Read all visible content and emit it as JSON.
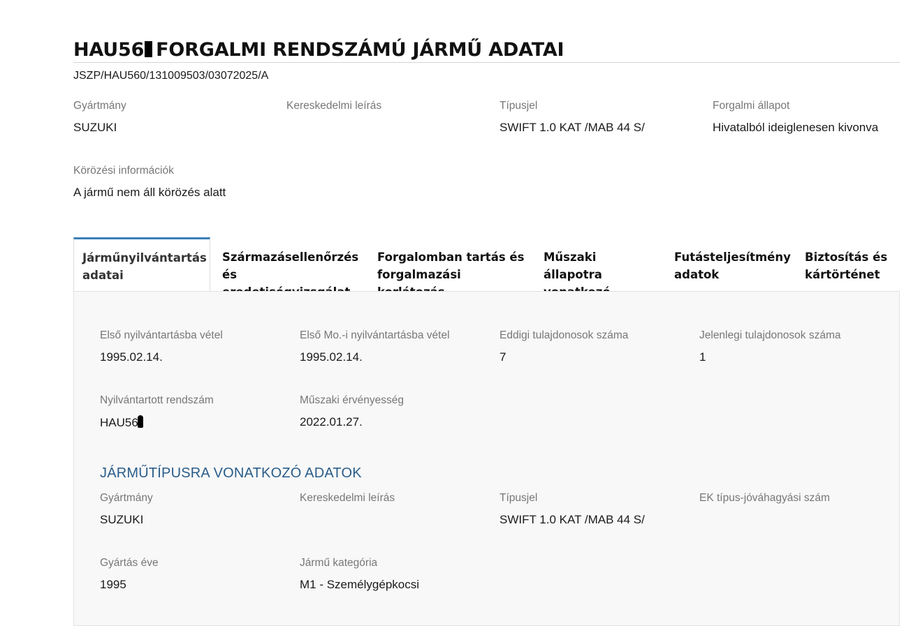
{
  "header": {
    "plate_prefix": "HAU56",
    "title_rest": "FORGALMI RENDSZÁMÚ JÁRMŰ ADATAI",
    "reference": "JSZP/HAU560/131009503/03072025/A"
  },
  "summary": {
    "gyartmany_label": "Gyártmány",
    "gyartmany_value": "SUZUKI",
    "kereskedelmi_label": "Kereskedelmi leírás",
    "kereskedelmi_value": "",
    "tipusjel_label": "Típusjel",
    "tipusjel_value": "SWIFT 1.0 KAT /MAB 44 S/",
    "allapot_label": "Forgalmi állapot",
    "allapot_value": "Hivatalból ideiglenesen kivonva",
    "korozes_label": "Körözési információk",
    "korozes_value": "A jármű nem áll körözés alatt"
  },
  "tabs": [
    {
      "line1": "Járműnyilvántartás",
      "line2": "adatai",
      "active": true
    },
    {
      "line1": "Származásellenőrzés",
      "line2": "és eredetiségvizsgálat"
    },
    {
      "line1": "Forgalomban tartás és",
      "line2": "forgalmazási korlátozás"
    },
    {
      "line1": "Műszaki állapotra",
      "line2": "vonatkozó adatok"
    },
    {
      "line1": "Futásteljesítmény",
      "line2": "adatok"
    },
    {
      "line1": "Biztosítás és",
      "line2": "kártörténet"
    }
  ],
  "registry": {
    "elso_label": "Első nyilvántartásba vétel",
    "elso_value": "1995.02.14.",
    "elso_mo_label": "Első Mo.-i nyilvántartásba vétel",
    "elso_mo_value": "1995.02.14.",
    "eddigi_label": "Eddigi tulajdonosok száma",
    "eddigi_value": "7",
    "jelenlegi_label": "Jelenlegi tulajdonosok száma",
    "jelenlegi_value": "1",
    "rendszam_label": "Nyilvántartott rendszám",
    "rendszam_value": "HAU56",
    "muszaki_label": "Műszaki érvényesség",
    "muszaki_value": "2022.01.27."
  },
  "vehicle_type": {
    "section_title": "JÁRMŰTÍPUSRA VONATKOZÓ ADATOK",
    "gyartmany_label": "Gyártmány",
    "gyartmany_value": "SUZUKI",
    "kereskedelmi_label": "Kereskedelmi leírás",
    "kereskedelmi_value": "",
    "tipusjel_label": "Típusjel",
    "tipusjel_value": "SWIFT 1.0 KAT /MAB 44 S/",
    "ek_label": "EK típus-jóváhagyási szám",
    "ek_value": "",
    "gyartas_label": "Gyártás éve",
    "gyartas_value": "1995",
    "kategoria_label": "Jármű kategória",
    "kategoria_value": "M1 - Személygépkocsi"
  }
}
